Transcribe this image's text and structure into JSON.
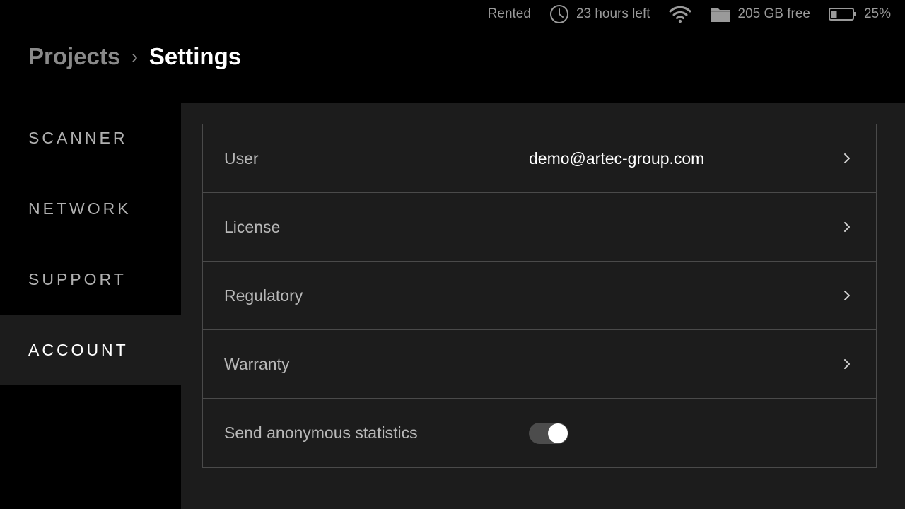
{
  "status_bar": {
    "rental": "Rented",
    "time_left": "23 hours left",
    "storage": "205 GB free",
    "battery": "25%",
    "battery_level": 0.25,
    "icons": [
      "clock-icon",
      "wifi-icon",
      "folder-icon",
      "battery-icon"
    ]
  },
  "breadcrumb": {
    "parent": "Projects",
    "separator": "›",
    "current": "Settings"
  },
  "sidebar": {
    "items": [
      {
        "label": "SCANNER",
        "active": false
      },
      {
        "label": "NETWORK",
        "active": false
      },
      {
        "label": "SUPPORT",
        "active": false
      },
      {
        "label": "ACCOUNT",
        "active": true
      }
    ]
  },
  "account": {
    "rows": [
      {
        "label": "User",
        "value": "demo@artec-group.com"
      },
      {
        "label": "License"
      },
      {
        "label": "Regulatory"
      },
      {
        "label": "Warranty"
      },
      {
        "label": "Send anonymous statistics",
        "toggle_on": true
      }
    ]
  },
  "colors": {
    "background": "#000000",
    "panel": "#1c1c1c",
    "border": "#4a4a4a",
    "text_primary": "#ffffff",
    "text_secondary": "#b8b8b8",
    "toggle_track": "#4c4c4c"
  }
}
